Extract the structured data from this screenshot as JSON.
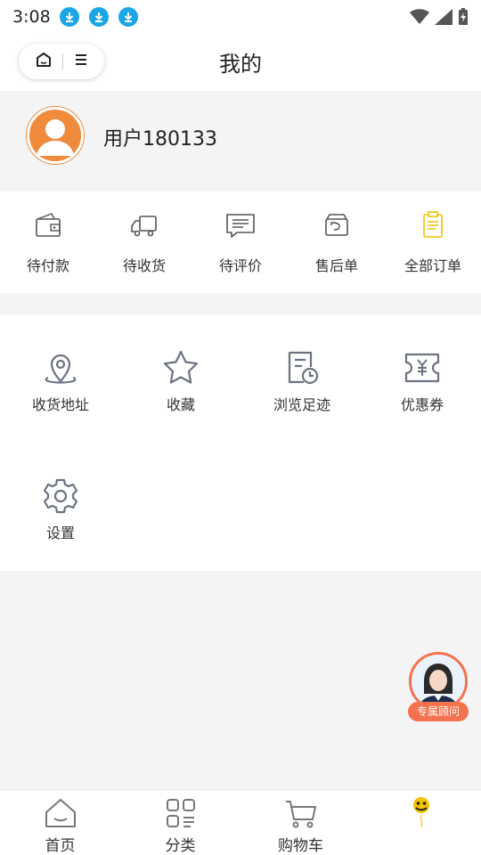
{
  "status_bar": {
    "time": "3:08"
  },
  "nav": {
    "title": "我的"
  },
  "profile": {
    "username": "用户180133"
  },
  "orders": [
    {
      "label": "待付款",
      "icon": "wallet-icon"
    },
    {
      "label": "待收货",
      "icon": "truck-icon"
    },
    {
      "label": "待评价",
      "icon": "comment-icon"
    },
    {
      "label": "售后单",
      "icon": "return-box-icon"
    },
    {
      "label": "全部订单",
      "icon": "clipboard-icon"
    }
  ],
  "services": [
    {
      "label": "收货地址",
      "icon": "location-pin-icon"
    },
    {
      "label": "收藏",
      "icon": "star-icon"
    },
    {
      "label": "浏览足迹",
      "icon": "history-doc-icon"
    },
    {
      "label": "优惠券",
      "icon": "coupon-icon"
    },
    {
      "label": "设置",
      "icon": "gear-icon"
    }
  ],
  "advisor": {
    "label": "专属顾问"
  },
  "tabs": [
    {
      "label": "首页",
      "icon": "home-icon"
    },
    {
      "label": "分类",
      "icon": "category-icon"
    },
    {
      "label": "购物车",
      "icon": "cart-icon"
    },
    {
      "label": "",
      "icon": "smiley-icon"
    }
  ],
  "colors": {
    "accent": "#f08a3c",
    "icon_gray": "#6b7280",
    "highlight": "#f2c400",
    "advisor": "#f4724d",
    "download": "#1aa6e6"
  }
}
